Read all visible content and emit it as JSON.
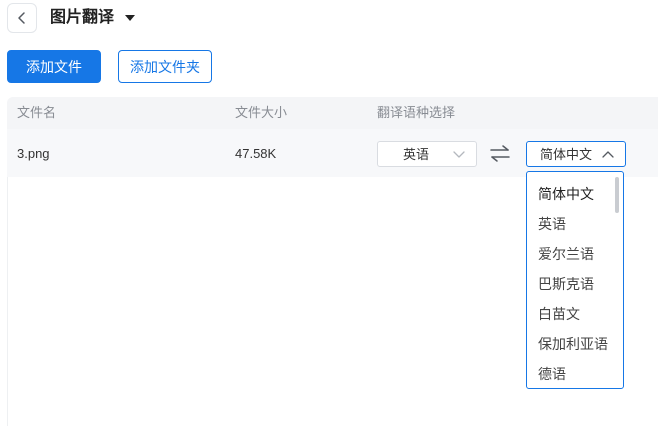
{
  "header": {
    "title": "图片翻译"
  },
  "toolbar": {
    "add_file_label": "添加文件",
    "add_folder_label": "添加文件夹"
  },
  "table": {
    "columns": [
      "文件名",
      "文件大小",
      "翻译语种选择"
    ],
    "rows": [
      {
        "file_name": "3.png",
        "file_size": "47.58K",
        "source_language": "英语",
        "target_language": "简体中文"
      }
    ]
  },
  "dropdown": {
    "open": true,
    "options": [
      "简体中文",
      "英语",
      "爱尔兰语",
      "巴斯克语",
      "白苗文",
      "保加利亚语",
      "德语"
    ],
    "selected": "简体中文"
  },
  "colors": {
    "accent": "#1677e6",
    "header_bg": "#f4f5f7",
    "row_bg": "#f7f8fa"
  },
  "icons": {
    "back": "chevron-left-icon",
    "title_menu": "caret-down-icon",
    "swap": "swap-arrows-icon",
    "source_select": "chevron-down-icon",
    "target_select": "chevron-up-icon"
  }
}
